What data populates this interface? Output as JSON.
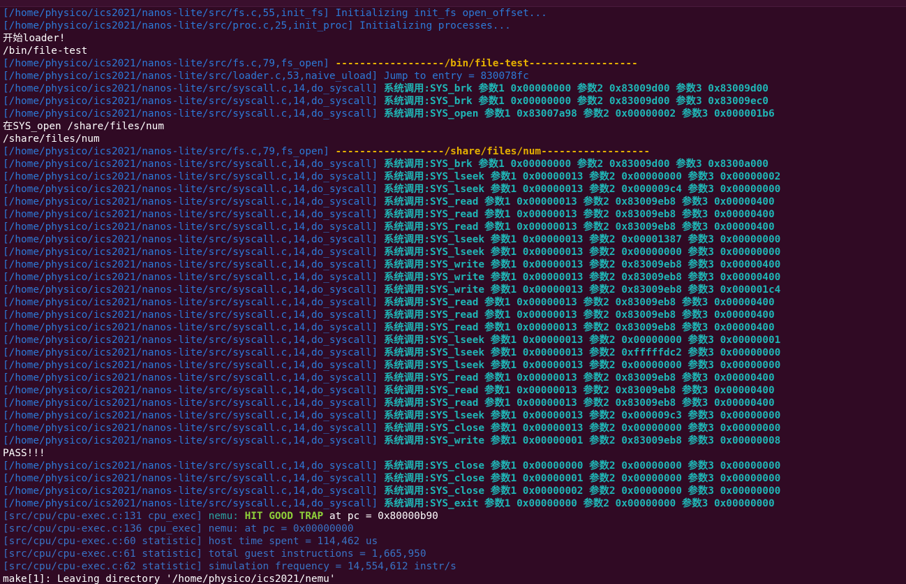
{
  "window": {
    "app": "terminal"
  },
  "lines": [
    [
      {
        "t": "[/home/physico/ics2021/nanos-lite/src/fs.c,55,init_fs] ",
        "c": "blue"
      },
      {
        "t": "Initializing init_fs open_offset...",
        "c": "blue"
      }
    ],
    [
      {
        "t": "[/home/physico/ics2021/nanos-lite/src/proc.c,25,init_proc] ",
        "c": "blue"
      },
      {
        "t": "Initializing processes...",
        "c": "blue"
      }
    ],
    [
      {
        "t": "开始loader!",
        "c": "white"
      }
    ],
    [
      {
        "t": "/bin/file-test",
        "c": "white"
      }
    ],
    [
      {
        "t": "[/home/physico/ics2021/nanos-lite/src/fs.c,79,fs_open] ",
        "c": "blue"
      },
      {
        "t": "------------------/bin/file-test------------------",
        "c": "yellow"
      }
    ],
    [
      {
        "t": "[/home/physico/ics2021/nanos-lite/src/loader.c,53,naive_uload] ",
        "c": "blue"
      },
      {
        "t": "Jump to entry = 830078fc",
        "c": "blue"
      }
    ],
    [
      {
        "t": "[/home/physico/ics2021/nanos-lite/src/syscall.c,14,do_syscall] ",
        "c": "blue"
      },
      {
        "t": "系统调用:SYS_brk 参数1 0x00000000 参数2 0x83009d00 参数3 0x83009d00",
        "c": "cyan"
      }
    ],
    [
      {
        "t": "[/home/physico/ics2021/nanos-lite/src/syscall.c,14,do_syscall] ",
        "c": "blue"
      },
      {
        "t": "系统调用:SYS_brk 参数1 0x00000000 参数2 0x83009d00 参数3 0x83009ec0",
        "c": "cyan"
      }
    ],
    [
      {
        "t": "[/home/physico/ics2021/nanos-lite/src/syscall.c,14,do_syscall] ",
        "c": "blue"
      },
      {
        "t": "系统调用:SYS_open 参数1 0x83007a98 参数2 0x00000002 参数3 0x000001b6",
        "c": "cyan"
      }
    ],
    [
      {
        "t": "在SYS_open /share/files/num",
        "c": "white"
      }
    ],
    [
      {
        "t": "/share/files/num",
        "c": "white"
      }
    ],
    [
      {
        "t": "[/home/physico/ics2021/nanos-lite/src/fs.c,79,fs_open] ",
        "c": "blue"
      },
      {
        "t": "------------------/share/files/num------------------",
        "c": "yellow"
      }
    ],
    [
      {
        "t": "[/home/physico/ics2021/nanos-lite/src/syscall.c,14,do_syscall] ",
        "c": "blue"
      },
      {
        "t": "系统调用:SYS_brk 参数1 0x00000000 参数2 0x83009d00 参数3 0x8300a000",
        "c": "cyan"
      }
    ],
    [
      {
        "t": "[/home/physico/ics2021/nanos-lite/src/syscall.c,14,do_syscall] ",
        "c": "blue"
      },
      {
        "t": "系统调用:SYS_lseek 参数1 0x00000013 参数2 0x00000000 参数3 0x00000002",
        "c": "cyan"
      }
    ],
    [
      {
        "t": "[/home/physico/ics2021/nanos-lite/src/syscall.c,14,do_syscall] ",
        "c": "blue"
      },
      {
        "t": "系统调用:SYS_lseek 参数1 0x00000013 参数2 0x000009c4 参数3 0x00000000",
        "c": "cyan"
      }
    ],
    [
      {
        "t": "[/home/physico/ics2021/nanos-lite/src/syscall.c,14,do_syscall] ",
        "c": "blue"
      },
      {
        "t": "系统调用:SYS_read 参数1 0x00000013 参数2 0x83009eb8 参数3 0x00000400",
        "c": "cyan"
      }
    ],
    [
      {
        "t": "[/home/physico/ics2021/nanos-lite/src/syscall.c,14,do_syscall] ",
        "c": "blue"
      },
      {
        "t": "系统调用:SYS_read 参数1 0x00000013 参数2 0x83009eb8 参数3 0x00000400",
        "c": "cyan"
      }
    ],
    [
      {
        "t": "[/home/physico/ics2021/nanos-lite/src/syscall.c,14,do_syscall] ",
        "c": "blue"
      },
      {
        "t": "系统调用:SYS_read 参数1 0x00000013 参数2 0x83009eb8 参数3 0x00000400",
        "c": "cyan"
      }
    ],
    [
      {
        "t": "[/home/physico/ics2021/nanos-lite/src/syscall.c,14,do_syscall] ",
        "c": "blue"
      },
      {
        "t": "系统调用:SYS_lseek 参数1 0x00000013 参数2 0x00001387 参数3 0x00000000",
        "c": "cyan"
      }
    ],
    [
      {
        "t": "[/home/physico/ics2021/nanos-lite/src/syscall.c,14,do_syscall] ",
        "c": "blue"
      },
      {
        "t": "系统调用:SYS_lseek 参数1 0x00000013 参数2 0x00000000 参数3 0x00000000",
        "c": "cyan"
      }
    ],
    [
      {
        "t": "[/home/physico/ics2021/nanos-lite/src/syscall.c,14,do_syscall] ",
        "c": "blue"
      },
      {
        "t": "系统调用:SYS_write 参数1 0x00000013 参数2 0x83009eb8 参数3 0x00000400",
        "c": "cyan"
      }
    ],
    [
      {
        "t": "[/home/physico/ics2021/nanos-lite/src/syscall.c,14,do_syscall] ",
        "c": "blue"
      },
      {
        "t": "系统调用:SYS_write 参数1 0x00000013 参数2 0x83009eb8 参数3 0x00000400",
        "c": "cyan"
      }
    ],
    [
      {
        "t": "[/home/physico/ics2021/nanos-lite/src/syscall.c,14,do_syscall] ",
        "c": "blue"
      },
      {
        "t": "系统调用:SYS_write 参数1 0x00000013 参数2 0x83009eb8 参数3 0x000001c4",
        "c": "cyan"
      }
    ],
    [
      {
        "t": "[/home/physico/ics2021/nanos-lite/src/syscall.c,14,do_syscall] ",
        "c": "blue"
      },
      {
        "t": "系统调用:SYS_read 参数1 0x00000013 参数2 0x83009eb8 参数3 0x00000400",
        "c": "cyan"
      }
    ],
    [
      {
        "t": "[/home/physico/ics2021/nanos-lite/src/syscall.c,14,do_syscall] ",
        "c": "blue"
      },
      {
        "t": "系统调用:SYS_read 参数1 0x00000013 参数2 0x83009eb8 参数3 0x00000400",
        "c": "cyan"
      }
    ],
    [
      {
        "t": "[/home/physico/ics2021/nanos-lite/src/syscall.c,14,do_syscall] ",
        "c": "blue"
      },
      {
        "t": "系统调用:SYS_read 参数1 0x00000013 参数2 0x83009eb8 参数3 0x00000400",
        "c": "cyan"
      }
    ],
    [
      {
        "t": "[/home/physico/ics2021/nanos-lite/src/syscall.c,14,do_syscall] ",
        "c": "blue"
      },
      {
        "t": "系统调用:SYS_lseek 参数1 0x00000013 参数2 0x00000000 参数3 0x00000001",
        "c": "cyan"
      }
    ],
    [
      {
        "t": "[/home/physico/ics2021/nanos-lite/src/syscall.c,14,do_syscall] ",
        "c": "blue"
      },
      {
        "t": "系统调用:SYS_lseek 参数1 0x00000013 参数2 0xfffffdc2 参数3 0x00000000",
        "c": "cyan"
      }
    ],
    [
      {
        "t": "[/home/physico/ics2021/nanos-lite/src/syscall.c,14,do_syscall] ",
        "c": "blue"
      },
      {
        "t": "系统调用:SYS_lseek 参数1 0x00000013 参数2 0x00000000 参数3 0x00000000",
        "c": "cyan"
      }
    ],
    [
      {
        "t": "[/home/physico/ics2021/nanos-lite/src/syscall.c,14,do_syscall] ",
        "c": "blue"
      },
      {
        "t": "系统调用:SYS_read 参数1 0x00000013 参数2 0x83009eb8 参数3 0x00000400",
        "c": "cyan"
      }
    ],
    [
      {
        "t": "[/home/physico/ics2021/nanos-lite/src/syscall.c,14,do_syscall] ",
        "c": "blue"
      },
      {
        "t": "系统调用:SYS_read 参数1 0x00000013 参数2 0x83009eb8 参数3 0x00000400",
        "c": "cyan"
      }
    ],
    [
      {
        "t": "[/home/physico/ics2021/nanos-lite/src/syscall.c,14,do_syscall] ",
        "c": "blue"
      },
      {
        "t": "系统调用:SYS_read 参数1 0x00000013 参数2 0x83009eb8 参数3 0x00000400",
        "c": "cyan"
      }
    ],
    [
      {
        "t": "[/home/physico/ics2021/nanos-lite/src/syscall.c,14,do_syscall] ",
        "c": "blue"
      },
      {
        "t": "系统调用:SYS_lseek 参数1 0x00000013 参数2 0x000009c3 参数3 0x00000000",
        "c": "cyan"
      }
    ],
    [
      {
        "t": "[/home/physico/ics2021/nanos-lite/src/syscall.c,14,do_syscall] ",
        "c": "blue"
      },
      {
        "t": "系统调用:SYS_close 参数1 0x00000013 参数2 0x00000000 参数3 0x00000000",
        "c": "cyan"
      }
    ],
    [
      {
        "t": "[/home/physico/ics2021/nanos-lite/src/syscall.c,14,do_syscall] ",
        "c": "blue"
      },
      {
        "t": "系统调用:SYS_write 参数1 0x00000001 参数2 0x83009eb8 参数3 0x00000008",
        "c": "cyan"
      }
    ],
    [
      {
        "t": "PASS!!!",
        "c": "white"
      }
    ],
    [
      {
        "t": "[/home/physico/ics2021/nanos-lite/src/syscall.c,14,do_syscall] ",
        "c": "blue"
      },
      {
        "t": "系统调用:SYS_close 参数1 0x00000000 参数2 0x00000000 参数3 0x00000000",
        "c": "cyan"
      }
    ],
    [
      {
        "t": "[/home/physico/ics2021/nanos-lite/src/syscall.c,14,do_syscall] ",
        "c": "blue"
      },
      {
        "t": "系统调用:SYS_close 参数1 0x00000001 参数2 0x00000000 参数3 0x00000000",
        "c": "cyan"
      }
    ],
    [
      {
        "t": "[/home/physico/ics2021/nanos-lite/src/syscall.c,14,do_syscall] ",
        "c": "blue"
      },
      {
        "t": "系统调用:SYS_close 参数1 0x00000002 参数2 0x00000000 参数3 0x00000000",
        "c": "cyan"
      }
    ],
    [
      {
        "t": "[/home/physico/ics2021/nanos-lite/src/syscall.c,14,do_syscall] ",
        "c": "blue"
      },
      {
        "t": "系统调用:SYS_exit 参数1 0x00000000 参数2 0x00000000 参数3 0x00000000",
        "c": "cyan"
      }
    ],
    [
      {
        "t": "[src/cpu/cpu-exec.c:131 cpu_exec] ",
        "c": "blue-dark"
      },
      {
        "t": "nemu: ",
        "c": "teal"
      },
      {
        "t": "HIT GOOD TRAP",
        "c": "green"
      },
      {
        "t": " at pc = 0x80000b90",
        "c": "white"
      }
    ],
    [
      {
        "t": "[src/cpu/cpu-exec.c:136 cpu_exec] ",
        "c": "blue-dark"
      },
      {
        "t": "nemu: at pc = 0x00000000",
        "c": "blue-dark"
      }
    ],
    [
      {
        "t": "[src/cpu/cpu-exec.c:60 statistic] ",
        "c": "blue-dark"
      },
      {
        "t": "host time spent = 114,462 us",
        "c": "blue-dark"
      }
    ],
    [
      {
        "t": "[src/cpu/cpu-exec.c:61 statistic] ",
        "c": "blue-dark"
      },
      {
        "t": "total guest instructions = 1,665,950",
        "c": "blue-dark"
      }
    ],
    [
      {
        "t": "[src/cpu/cpu-exec.c:62 statistic] ",
        "c": "blue-dark"
      },
      {
        "t": "simulation frequency = 14,554,612 instr/s",
        "c": "blue-dark"
      }
    ],
    [
      {
        "t": "make[1]: Leaving directory '/home/physico/ics2021/nemu'",
        "c": "white"
      }
    ]
  ],
  "colors": {
    "background": "#300a24",
    "blue": "#2d7ad7",
    "blue-dark": "#3873c5",
    "cyan": "#1fb6b6",
    "teal": "#2aa3a3",
    "yellow": "#e5b000",
    "green": "#8fd13a",
    "white": "#ffffff"
  }
}
